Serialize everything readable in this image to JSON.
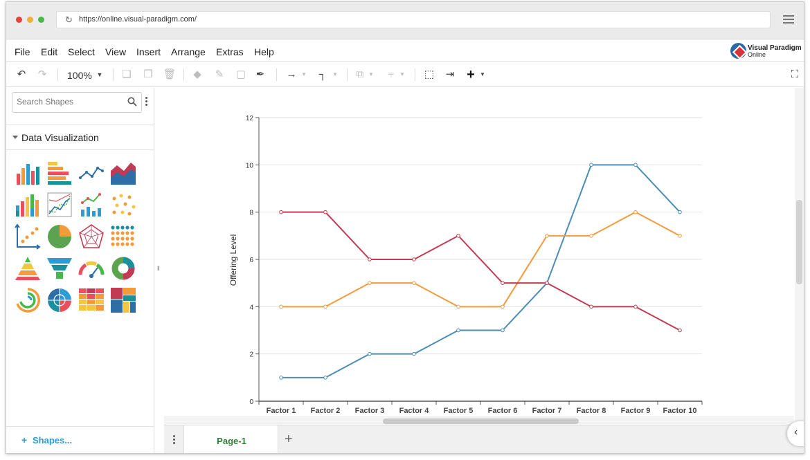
{
  "browser": {
    "url": "https://online.visual-paradigm.com/",
    "dots": [
      "#e0463a",
      "#f0b13a",
      "#49b84a"
    ]
  },
  "app": {
    "logo_line1": "Visual Paradigm",
    "logo_line2": "Online"
  },
  "menu": {
    "items": [
      "File",
      "Edit",
      "Select",
      "View",
      "Insert",
      "Arrange",
      "Extras",
      "Help"
    ]
  },
  "toolbar": {
    "zoom": "100%"
  },
  "sidebar": {
    "search_placeholder": "Search Shapes",
    "section_title": "Data Visualization",
    "more_shapes": "Shapes..."
  },
  "pages": {
    "active": "Page-1"
  },
  "colors": {
    "blue": "#4a8db5",
    "orange": "#f59a3a",
    "crimson": "#c23b55",
    "accent": "#2d9bd5"
  },
  "chart_data": {
    "type": "line",
    "title": "",
    "xlabel": "",
    "ylabel": "Offering Level",
    "categories": [
      "Factor 1",
      "Factor 2",
      "Factor 3",
      "Factor 4",
      "Factor 5",
      "Factor 6",
      "Factor 7",
      "Factor 8",
      "Factor 9",
      "Factor 10"
    ],
    "ylim": [
      0,
      12
    ],
    "yticks": [
      0,
      2,
      4,
      6,
      8,
      10,
      12
    ],
    "grid": "horizontal",
    "series": [
      {
        "values": [
          1,
          1,
          2,
          2,
          3,
          3,
          5,
          10,
          10,
          8
        ],
        "color": "#4a8db5"
      },
      {
        "values": [
          4,
          4,
          5,
          5,
          4,
          4,
          7,
          7,
          8,
          7
        ],
        "color": "#f59a3a"
      },
      {
        "values": [
          8,
          8,
          6,
          6,
          7,
          5,
          5,
          4,
          4,
          3
        ],
        "color": "#c23b55"
      }
    ]
  }
}
